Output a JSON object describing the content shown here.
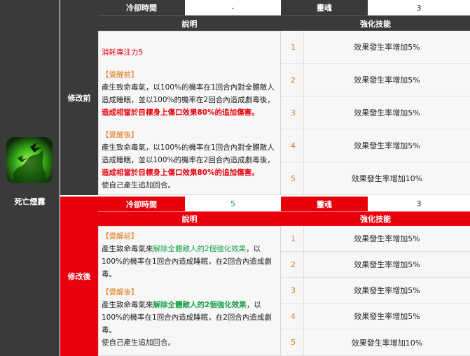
{
  "skill": {
    "name": "死亡煙霧"
  },
  "before": {
    "section_label": "修改前",
    "cooldown_label": "冷卻時間",
    "cooldown_value": "-",
    "soul_label": "靈魂",
    "soul_value": "3",
    "desc_header": "說明",
    "enhance_header": "強化技能",
    "cost": "消耗專注力5",
    "pre_tag": "【覺醒前】",
    "pre_a": "產生致命毒氣，以100%的機率在1回合內對全體敵人造成睡眠，並以100%的機率在2回合內造成劇毒後，",
    "pre_b": "造成相當於目標身上傷口效果80%的追加傷害。",
    "post_tag": "【覺醒後】",
    "post_a": "產生致命毒氣，以100%的機率在1回合內對全體敵人造成睡眠，並以100%的機率在2回合內造成劇毒後，",
    "post_b": "造成相當於目標身上傷口效果80%的追加傷害。",
    "post_c": "使自己產生追加回合。",
    "enhance": [
      {
        "level": "1",
        "effect": "效果發生率增加5%"
      },
      {
        "level": "2",
        "effect": "效果發生率增加5%"
      },
      {
        "level": "3",
        "effect": "效果發生率增加5%"
      },
      {
        "level": "4",
        "effect": "效果發生率增加5%"
      },
      {
        "level": "5",
        "effect": "效果發生率增加10%"
      }
    ]
  },
  "after": {
    "section_label": "修改後",
    "cooldown_label": "冷卻時間",
    "cooldown_value": "5",
    "soul_label": "靈魂",
    "soul_value": "3",
    "desc_header": "說明",
    "enhance_header": "強化技能",
    "pre_tag": "【覺醒前】",
    "pre_a": "產生致命毒氣來",
    "pre_b": "解除全體敵人的2個強化效果",
    "pre_c": "，以100%的機率在1回合內造成睡眠，在2回合內造成劇毒。",
    "post_tag": "【覺醒後】",
    "post_a": "產生致命毒氣來",
    "post_b": "解除全體敵人的2個強化效果",
    "post_c": "，以100%的機率在1回合內造成睡眠，在2回合內造成劇毒。",
    "post_d": "使自己產生追加回合。",
    "enhance": [
      {
        "level": "1",
        "effect": "效果發生率增加5%"
      },
      {
        "level": "2",
        "effect": "效果發生率增加5%"
      },
      {
        "level": "3",
        "effect": "效果發生率增加5%"
      },
      {
        "level": "4",
        "effect": "效果發生率增加5%"
      },
      {
        "level": "5",
        "effect": "效果發生率增加10%"
      }
    ]
  },
  "colors": {
    "dark_header": "#3a3a3a",
    "red_header": "#e8000d",
    "level_orange": "#e07a1a",
    "effect_green": "#19a04a"
  }
}
